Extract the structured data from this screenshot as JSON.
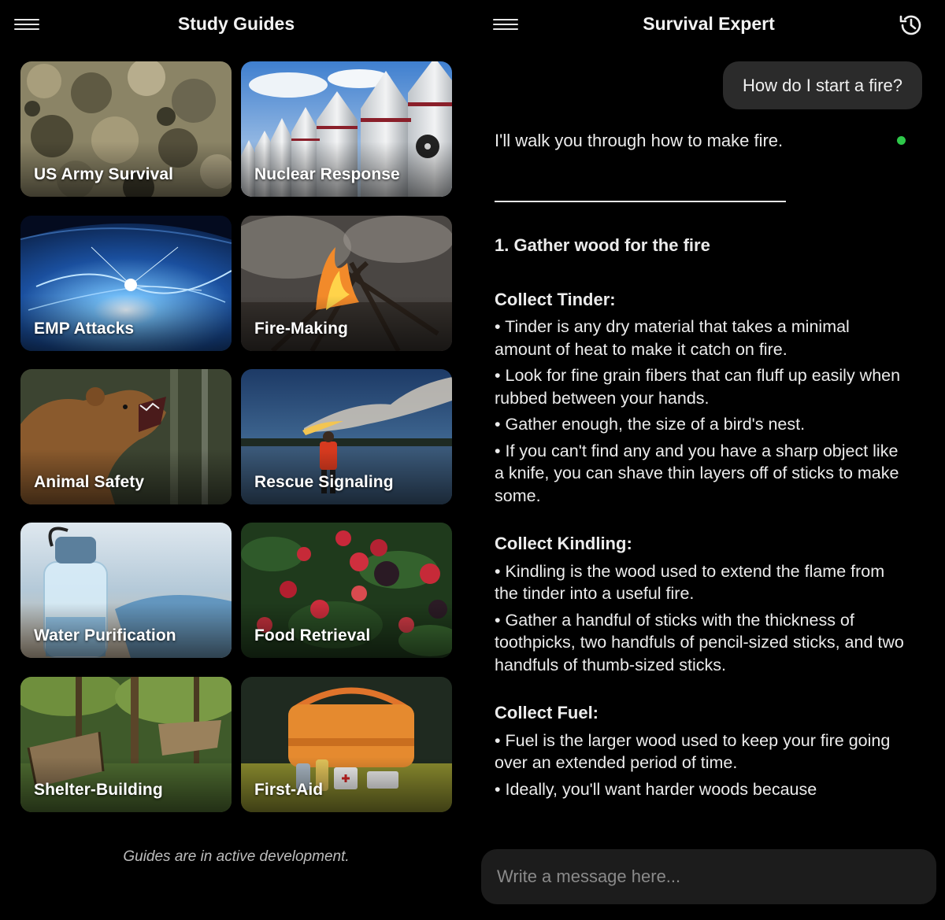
{
  "left_panel": {
    "title": "Study Guides",
    "guides": [
      {
        "label": "US Army Survival"
      },
      {
        "label": "Nuclear Response"
      },
      {
        "label": "EMP Attacks"
      },
      {
        "label": "Fire-Making"
      },
      {
        "label": "Animal Safety"
      },
      {
        "label": "Rescue Signaling"
      },
      {
        "label": "Water Purification"
      },
      {
        "label": "Food Retrieval"
      },
      {
        "label": "Shelter-Building"
      },
      {
        "label": "First-Aid"
      }
    ],
    "footnote": "Guides are in active development."
  },
  "right_panel": {
    "title": "Survival Expert",
    "user_message": "How do I start a fire?",
    "assistant_intro": "I'll walk you through how to make fire.",
    "step_title": "1. Gather wood for the fire",
    "sections": [
      {
        "heading": "Collect Tinder:",
        "bullets": [
          "• Tinder is any dry material that takes a minimal amount of heat to make it catch on fire.",
          "• Look for fine grain fibers that can fluff up easily when rubbed between your hands.",
          "• Gather enough, the size of a bird's nest.",
          "• If you can't find any and you have a sharp object like a knife, you can shave thin layers off of sticks to make some."
        ]
      },
      {
        "heading": "Collect Kindling:",
        "bullets": [
          "• Kindling is the wood used to extend the flame from the tinder into a useful fire.",
          "• Gather a handful of sticks with the thickness of toothpicks, two handfuls of pencil-sized sticks, and two handfuls of thumb-sized sticks."
        ]
      },
      {
        "heading": "Collect Fuel:",
        "bullets": [
          "• Fuel is the larger wood used to keep your fire going over an extended period of time.",
          "• Ideally, you'll want harder woods because"
        ]
      }
    ],
    "composer": {
      "placeholder": "Write a message here..."
    }
  },
  "icons": {
    "menu": "hamburger-menu-icon",
    "history": "history-clock-icon",
    "status": "online-status-dot"
  },
  "colors": {
    "background": "#000000",
    "bubble": "#2b2b2b",
    "composer": "#1c1c1c",
    "status_green": "#2ec84a"
  }
}
